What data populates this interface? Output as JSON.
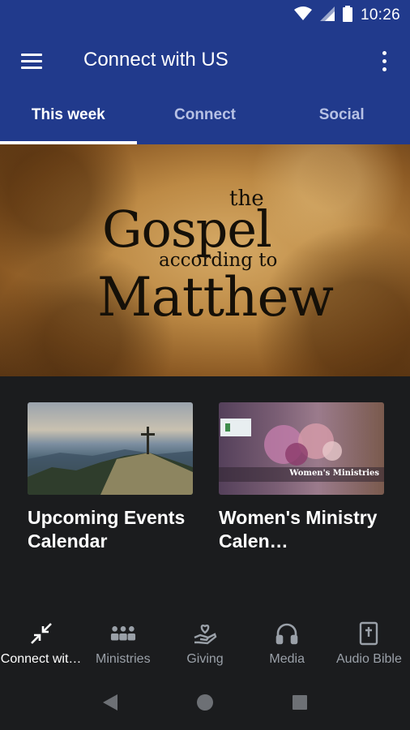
{
  "status_bar": {
    "time": "10:26"
  },
  "app_bar": {
    "title": "Connect with US"
  },
  "tabs": [
    {
      "label": "This week",
      "active": true
    },
    {
      "label": "Connect",
      "active": false
    },
    {
      "label": "Social",
      "active": false
    }
  ],
  "hero": {
    "line_the": "the",
    "line_gospel": "Gospel",
    "line_according": "according to",
    "line_matthew": "Matthew"
  },
  "cards": [
    {
      "title": "Upcoming Events Calendar",
      "image": "mountain-cross-image"
    },
    {
      "title": "Women's Ministry Calen…",
      "image": "womens-ministries-image",
      "thumb_caption": "Women's Ministries"
    }
  ],
  "bottom_nav": [
    {
      "label": "Connect wit…",
      "icon": "collapse-arrows-icon",
      "active": true
    },
    {
      "label": "Ministries",
      "icon": "group-icon",
      "active": false
    },
    {
      "label": "Giving",
      "icon": "hand-heart-icon",
      "active": false
    },
    {
      "label": "Media",
      "icon": "headphones-icon",
      "active": false
    },
    {
      "label": "Audio Bible",
      "icon": "bible-icon",
      "active": false
    }
  ],
  "colors": {
    "primary": "#213a8c",
    "background": "#1b1c1e",
    "inactive_tab": "#b7c1e4",
    "inactive_nav": "#9aa0a8"
  }
}
